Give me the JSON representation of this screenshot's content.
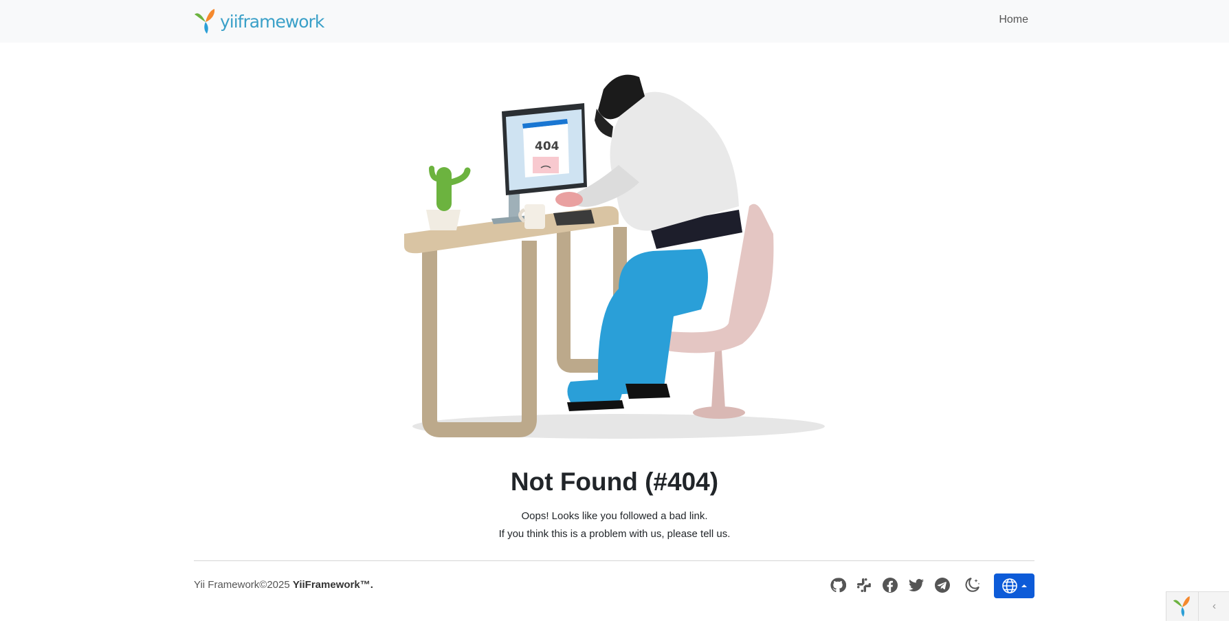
{
  "header": {
    "brand": "yiiframework",
    "nav": [
      {
        "label": "Home"
      }
    ]
  },
  "illustration": {
    "screen_text": "404"
  },
  "error": {
    "title": "Not Found (#404)",
    "line1": "Oops! Looks like you followed a bad link.",
    "line2": "If you think this is a problem with us, please tell us."
  },
  "footer": {
    "copyright": "Yii Framework©2025",
    "brand": "YiiFramework™.",
    "social": [
      "github-icon",
      "slack-icon",
      "facebook-icon",
      "twitter-icon",
      "telegram-icon",
      "theme-toggle-icon"
    ]
  },
  "colors": {
    "navbar_bg": "#f8f9fa",
    "brand": "#3aa0c8",
    "language_button": "#0d5bd8"
  }
}
